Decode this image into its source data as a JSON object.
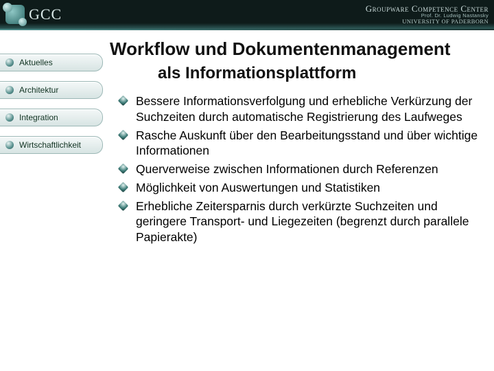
{
  "header": {
    "logo_text": "GCC",
    "org_main": "Groupware Competence Center",
    "org_sub": "Prof. Dr. Ludwig Nastansky",
    "org_uni": "UNIVERSITY OF PADERBORN"
  },
  "title": "Workflow und Dokumentenmanagement",
  "subtitle": "als Informationsplattform",
  "sidebar": {
    "items": [
      {
        "label": "Aktuelles"
      },
      {
        "label": "Architektur"
      },
      {
        "label": "Integration"
      },
      {
        "label": "Wirtschaftlichkeit"
      }
    ]
  },
  "bullets": [
    "Bessere Informationsverfolgung und erhebliche Verkürzung der Suchzeiten durch automatische Registrierung des Laufweges",
    "Rasche Auskunft über den Bearbeitungsstand und über wichtige Informationen",
    "Querverweise zwischen Informationen durch Referenzen",
    "Möglichkeit von Auswertungen und Statistiken",
    "Erhebliche Zeitersparnis durch verkürzte Suchzeiten und geringere Transport- und Liegezeiten (begrenzt durch parallele Papierakte)"
  ]
}
